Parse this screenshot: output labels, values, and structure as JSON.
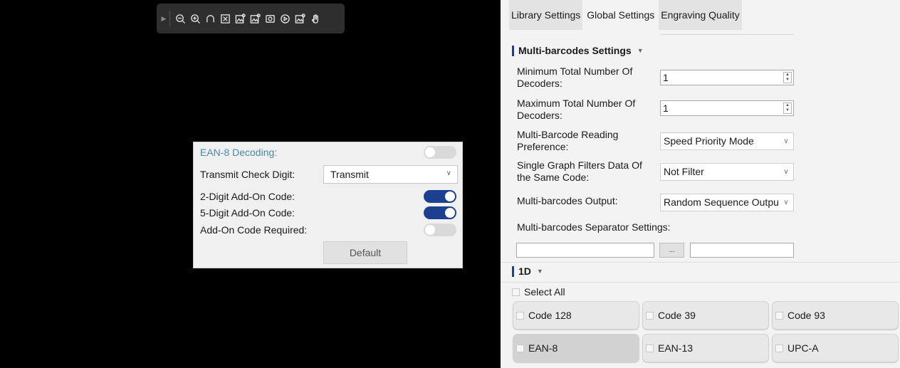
{
  "toolbar": {
    "icons": [
      "expand-arrow-icon",
      "zoom-out-icon",
      "zoom-in-icon",
      "rotate-icon",
      "fit-image-icon",
      "image-settings-icon",
      "image-settings-2-icon",
      "snapshot-icon",
      "play-icon",
      "image-settings-3-icon",
      "hand-tool-icon"
    ]
  },
  "popup": {
    "title": "EAN-8 Decoding:",
    "enabled": false,
    "transmit_check_digit": {
      "label": "Transmit Check Digit:",
      "value": "Transmit"
    },
    "two_digit_addon": {
      "label": "2-Digit Add-On Code:",
      "enabled": true
    },
    "five_digit_addon": {
      "label": "5-Digit Add-On Code:",
      "enabled": true
    },
    "addon_required": {
      "label": "Add-On Code Required:",
      "enabled": false
    },
    "default_button": "Default"
  },
  "tabs": [
    {
      "label": "Library Settings",
      "active": false
    },
    {
      "label": "Global Settings",
      "active": true
    },
    {
      "label": "Engraving Quality",
      "active": false
    }
  ],
  "multi": {
    "header": "Multi-barcodes Settings",
    "min_label": "Minimum Total Number Of Decoders:",
    "min_value": "1",
    "max_label": "Maximum Total Number Of Decoders:",
    "max_value": "1",
    "pref_label": "Multi-Barcode Reading Preference:",
    "pref_value": "Speed Priority Mode",
    "filter_label": "Single Graph Filters Data Of the Same Code:",
    "filter_value": "Not Filter",
    "output_label": "Multi-barcodes Output:",
    "output_value": "Random Sequence Output",
    "separator_label": "Multi-barcodes Separator Settings:",
    "separator_button": "..."
  },
  "oned": {
    "header": "1D",
    "select_all": "Select All",
    "codes": [
      {
        "label": "Code 128",
        "selected": false
      },
      {
        "label": "Code 39",
        "selected": false
      },
      {
        "label": "Code 93",
        "selected": false
      },
      {
        "label": "EAN-8",
        "selected": true
      },
      {
        "label": "EAN-13",
        "selected": false
      },
      {
        "label": "UPC-A",
        "selected": false
      }
    ]
  },
  "colors": {
    "accent": "#1c3f8f",
    "title_teal": "#4a8aa6"
  }
}
